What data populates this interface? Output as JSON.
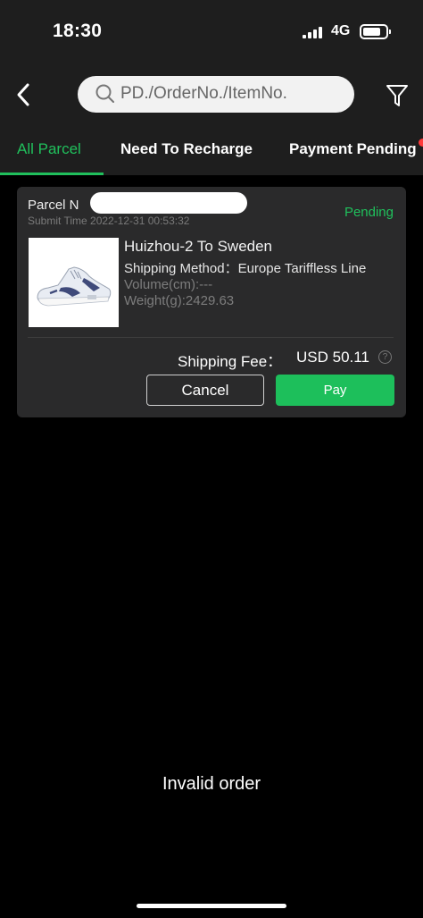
{
  "status_bar": {
    "time": "18:30",
    "network": "4G",
    "icons": [
      "signal-icon",
      "battery-icon"
    ]
  },
  "nav": {
    "back_icon": "chevron-left-icon",
    "search_placeholder": "PD./OrderNo./ItemNo.",
    "search_icon": "search-icon",
    "filter_icon": "filter-icon"
  },
  "tabs": [
    {
      "label": "All Parcel",
      "active": true
    },
    {
      "label": "Need To Recharge",
      "active": false
    },
    {
      "label": "Payment Pending",
      "active": false
    }
  ],
  "colors": {
    "accent": "#20c05c",
    "pay_button": "#1dbf5b",
    "header_bg": "#1e1e1e",
    "card_bg": "#2a2a2b",
    "page_bg": "#000000",
    "badge_dot": "#ff3b3b"
  },
  "parcel": {
    "label_prefix": "Parcel N",
    "submit_time": "Submit Time 2022-12-31 00:53:32",
    "status": "Pending",
    "route": "Huizhou-2 To Sweden",
    "shipping_method": "Shipping Method：Europe Tariffless Line",
    "volume": "Volume(cm):---",
    "weight": "Weight(g):2429.63",
    "shipping_fee_label": "Shipping Fee：",
    "shipping_fee_value": "USD 50.11",
    "help_icon": "?",
    "cancel_label": "Cancel",
    "pay_label": "Pay"
  },
  "caption": "Invalid order"
}
